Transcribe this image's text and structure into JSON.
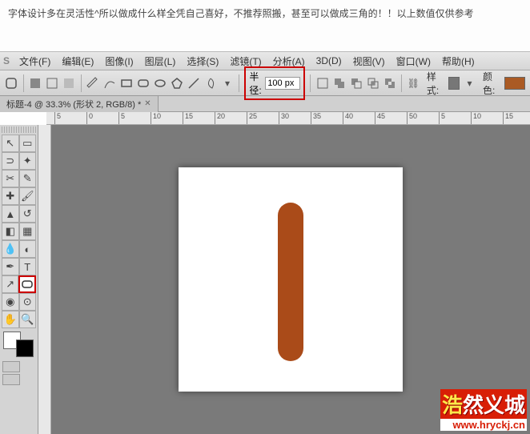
{
  "note": "字体设计多在灵活性^所以做成什么样全凭自己喜好，不推荐照搬，甚至可以做成三角的！！以上数值仅供参考",
  "menu": {
    "ps": "S",
    "items": [
      "文件(F)",
      "编辑(E)",
      "图像(I)",
      "图层(L)",
      "选择(S)",
      "滤镜(T)",
      "分析(A)",
      "3D(D)",
      "视图(V)",
      "窗口(W)",
      "帮助(H)"
    ]
  },
  "options": {
    "radius_label": "半径:",
    "radius_value": "100 px",
    "style_label": "样式:",
    "color_label": "颜色:",
    "shape_color": "#aa5a24"
  },
  "tab": {
    "title": "标题-4 @ 33.3% (形状 2, RGB/8) *"
  },
  "ruler_ticks": [
    "5",
    "0",
    "5",
    "10",
    "15",
    "20",
    "25",
    "30",
    "35",
    "40",
    "45",
    "50",
    "5",
    "10",
    "15"
  ],
  "watermark": {
    "cn_part1": "浩",
    "cn_part2": "然义城",
    "url": "www.hryckj.cn"
  }
}
